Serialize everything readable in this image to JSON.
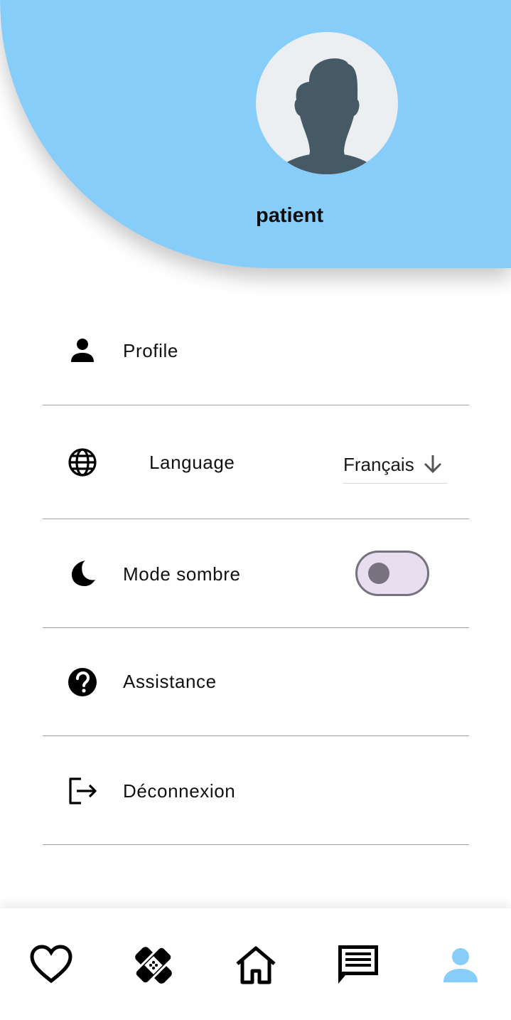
{
  "header": {
    "username": "patient",
    "avatar_icon": "default-avatar-icon",
    "background_color": "#87cdf9"
  },
  "menu": {
    "profile": {
      "label": "Profile",
      "icon": "person-icon"
    },
    "language": {
      "label": "Language",
      "icon": "globe-icon",
      "selected": "Français",
      "dropdown_icon": "arrow-down-icon"
    },
    "dark_mode": {
      "label": "Mode sombre",
      "icon": "moon-icon",
      "enabled": false
    },
    "assistance": {
      "label": "Assistance",
      "icon": "help-circle-icon"
    },
    "logout": {
      "label": "Déconnexion",
      "icon": "logout-icon"
    }
  },
  "bottom_nav": {
    "items": [
      {
        "name": "favorites",
        "icon": "heart-icon"
      },
      {
        "name": "care",
        "icon": "bandage-icon"
      },
      {
        "name": "home",
        "icon": "home-icon"
      },
      {
        "name": "messages",
        "icon": "chat-icon"
      },
      {
        "name": "profile",
        "icon": "person-icon",
        "active": true
      }
    ],
    "active_color": "#87cdf9"
  }
}
